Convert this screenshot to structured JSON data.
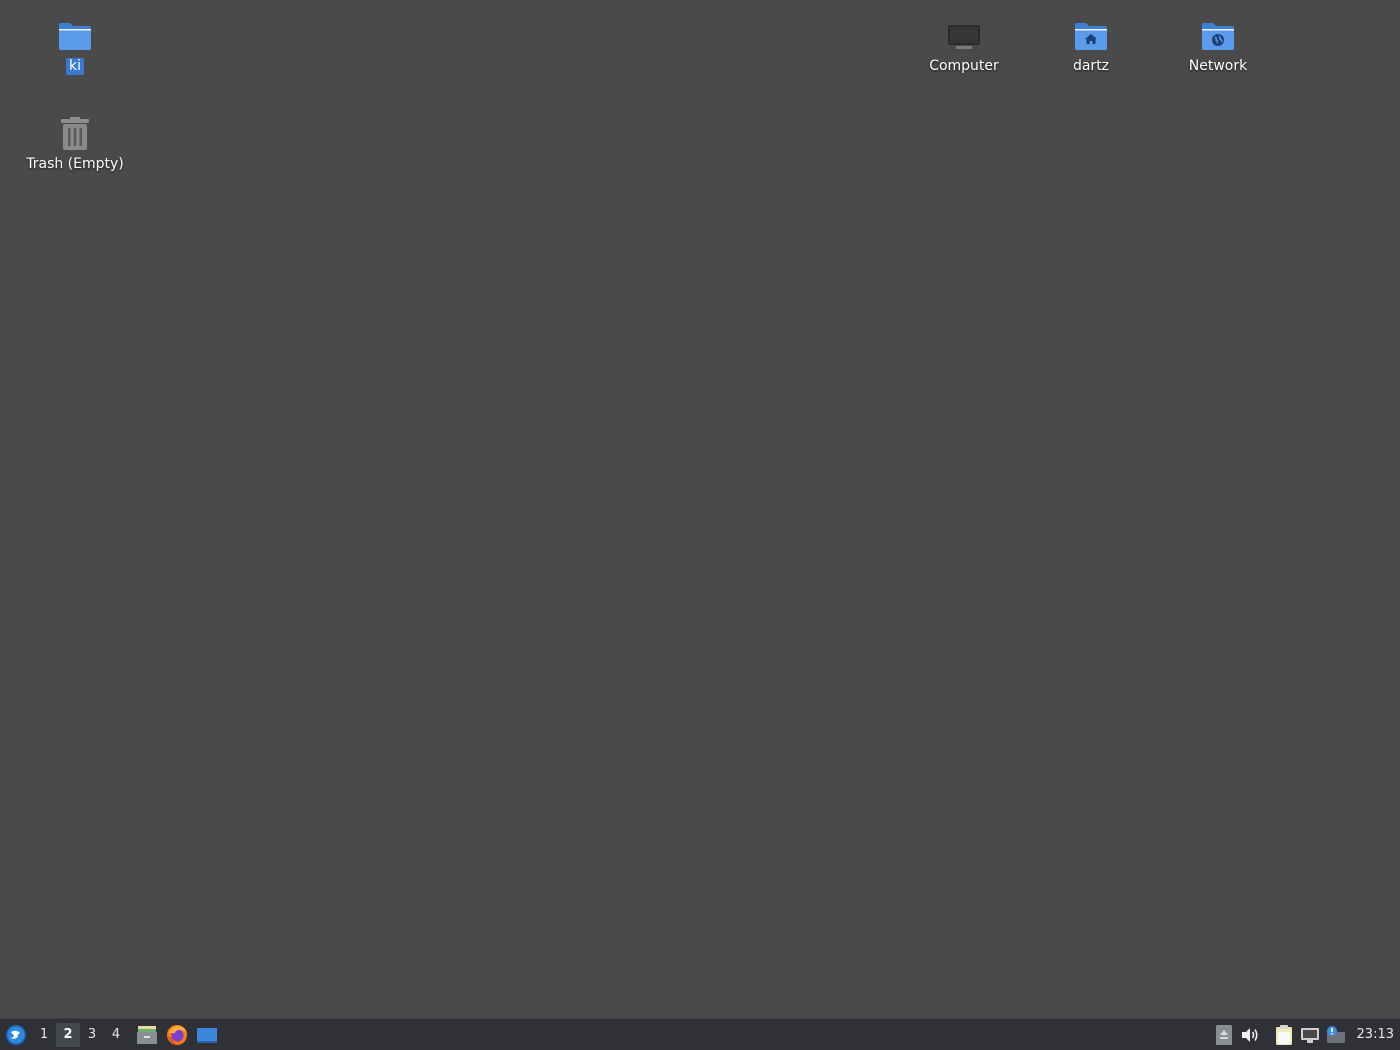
{
  "desktop": {
    "background_color": "#4a4a4a",
    "icons": [
      {
        "label": "ki",
        "icon": "folder-icon",
        "selected": true
      },
      {
        "label": "Trash (Empty)",
        "icon": "trash-icon",
        "selected": false
      },
      {
        "label": "Computer",
        "icon": "computer-icon",
        "selected": false
      },
      {
        "label": "dartz",
        "icon": "home-folder-icon",
        "selected": false
      },
      {
        "label": "Network",
        "icon": "network-folder-icon",
        "selected": false
      }
    ]
  },
  "taskbar": {
    "start_icon": "start-menu-icon",
    "workspaces": [
      {
        "label": "1",
        "active": false
      },
      {
        "label": "2",
        "active": true
      },
      {
        "label": "3",
        "active": false
      },
      {
        "label": "4",
        "active": false
      }
    ],
    "launchers": [
      {
        "icon": "file-manager-icon"
      },
      {
        "icon": "firefox-icon"
      },
      {
        "icon": "show-desktop-icon"
      }
    ],
    "tray": [
      {
        "icon": "eject-icon"
      },
      {
        "icon": "volume-icon"
      },
      {
        "icon": "clipboard-icon"
      },
      {
        "icon": "network-status-icon"
      },
      {
        "icon": "notification-icon"
      }
    ],
    "clock": "23:13"
  },
  "colors": {
    "folder_blue": "#4a8fe3",
    "selection": "#3a78d4",
    "taskbar": "#2f3136"
  }
}
